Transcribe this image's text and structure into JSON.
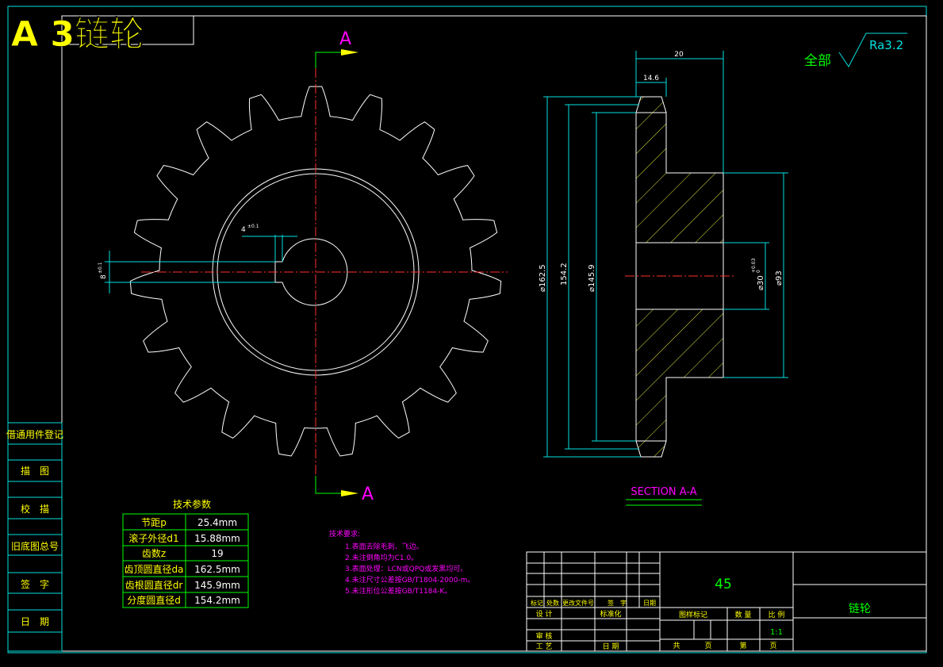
{
  "header": {
    "title": "A 3链轮",
    "title_color": "#ffff00"
  },
  "view_labels": {
    "section_mark_top": "A",
    "section_mark_bottom": "A",
    "section_title": "SECTION A-A"
  },
  "surface_finish": {
    "prefix": "全部",
    "roughness": "Ra3.2"
  },
  "dimensions": {
    "width_total": "20",
    "width_tooth": "14.6",
    "tip_diameter": "⌀162.5",
    "pitch_diameter": "154.2",
    "root_diameter": "⌀145.9",
    "bore": "⌀30",
    "bore_tol": "+0.03",
    "bore_tol_lower": "0",
    "hub_diameter": "⌀93",
    "keyway_width": "4",
    "keyway_width_tol": "±0.1",
    "keyway_depth": "8",
    "keyway_depth_tol": "±0.1"
  },
  "left_sidebar": [
    "借通用件登记",
    "描　图",
    "校　描",
    "旧底图总号",
    "签　字",
    "日　期"
  ],
  "tech_params": {
    "title": "技术参数",
    "rows": [
      {
        "name": "节距p",
        "value": "25.4mm"
      },
      {
        "name": "滚子外径d1",
        "value": "15.88mm"
      },
      {
        "name": "齿数z",
        "value": "19"
      },
      {
        "name": "齿顶圆直径da",
        "value": "162.5mm"
      },
      {
        "name": "齿根圆直径dr",
        "value": "145.9mm"
      },
      {
        "name": "分度圆直径d",
        "value": "154.2mm"
      }
    ]
  },
  "tech_requirements": {
    "title": "技术要求:",
    "items": [
      "1.表面去除毛刺、飞边。",
      "2.未注倒角均为C1.0。",
      "3.表面处理：LCN或QPQ或发黑均可。",
      "4.未注尺寸公差按GB/T1804-2000-m。",
      "5.未注形位公差按GB/T1184-K。"
    ]
  },
  "title_block": {
    "material": "45",
    "part_name": "链轮",
    "rev_headers": [
      "标记",
      "处数",
      "更改文件号",
      "签　字",
      "日期"
    ],
    "design": "设 计",
    "standardize": "标准化",
    "review": "审 核",
    "process": "工 艺",
    "date": "日 期",
    "stage_label": "图样标记",
    "qty_label": "数 量",
    "scale_label": "比 例",
    "scale": "1:1",
    "total_label": "共",
    "page_unit": "页",
    "sheet_label": "第",
    "sheet_unit": "页"
  }
}
